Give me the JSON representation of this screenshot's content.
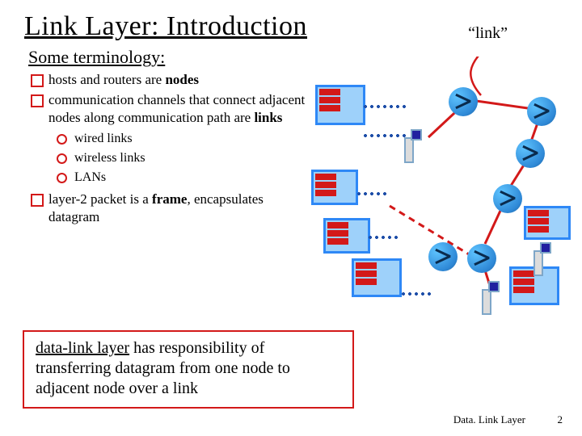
{
  "title": "Link Layer: Introduction",
  "subtitle": "Some terminology:",
  "bullets": {
    "b1_pre": "hosts and routers are ",
    "b1_bold": "nodes",
    "b2_pre": "communication channels that connect adjacent nodes along communication path are ",
    "b2_bold": "links",
    "sub1": "wired links",
    "sub2": "wireless links",
    "sub3": "LANs",
    "b3_pre": "layer-2 packet is a ",
    "b3_bold": "frame",
    "b3_post": ", encapsulates datagram"
  },
  "callout": {
    "lead": "data-link layer",
    "rest": " has responsibility of transferring datagram from one node to adjacent node over a link"
  },
  "link_label": "“link”",
  "footer": {
    "label": "Data. Link Layer",
    "page": "2"
  }
}
